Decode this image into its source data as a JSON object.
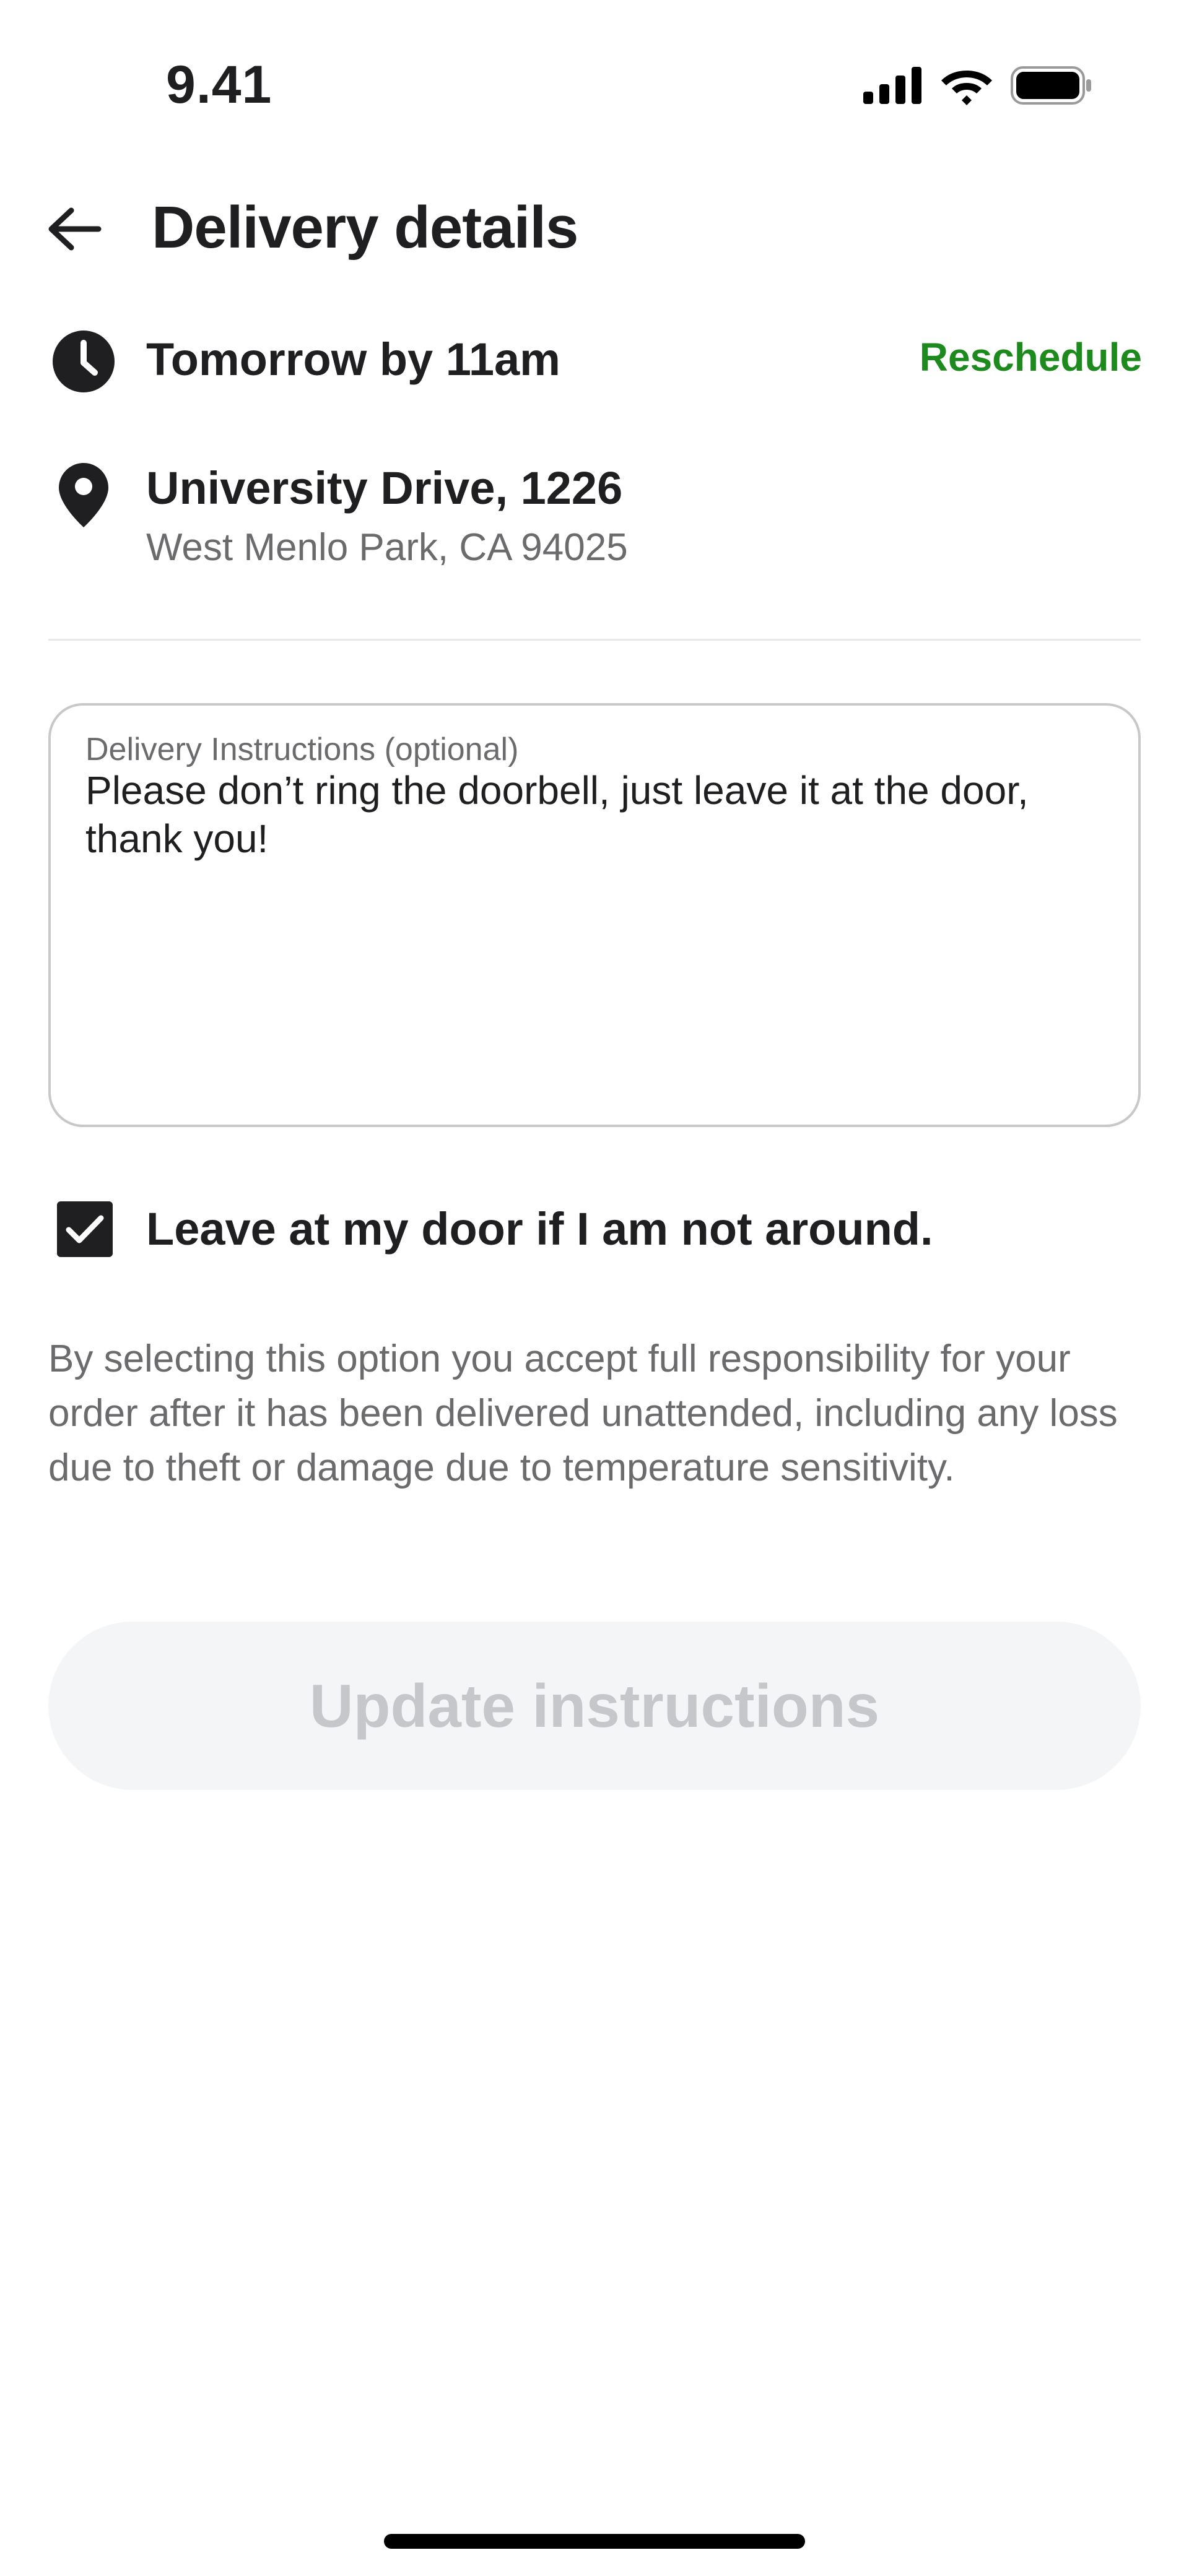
{
  "status_bar": {
    "time": "9.41",
    "icons": [
      "cellular-signal-icon",
      "wifi-icon",
      "battery-icon"
    ]
  },
  "header": {
    "title": "Delivery details",
    "back_icon": "arrow-left-icon"
  },
  "schedule": {
    "icon": "clock-icon",
    "text": "Tomorrow by 11am",
    "action_label": "Reschedule",
    "action_color": "#1d8a1d"
  },
  "address": {
    "icon": "location-pin-icon",
    "line1": "University Drive, 1226",
    "line2": "West Menlo Park, CA 94025"
  },
  "instructions": {
    "label": "Delivery Instructions (optional)",
    "value": "Please don’t ring the doorbell, just leave it at the door, thank you!"
  },
  "leave_at_door": {
    "checked": true,
    "label": "Leave at my door if I am not around."
  },
  "disclaimer": "By selecting this option you accept full responsibility for your order after it has been delivered unattended, including any loss due to theft or damage due to temperature sensitivity.",
  "update_button": {
    "label": "Update instructions",
    "disabled": true
  }
}
